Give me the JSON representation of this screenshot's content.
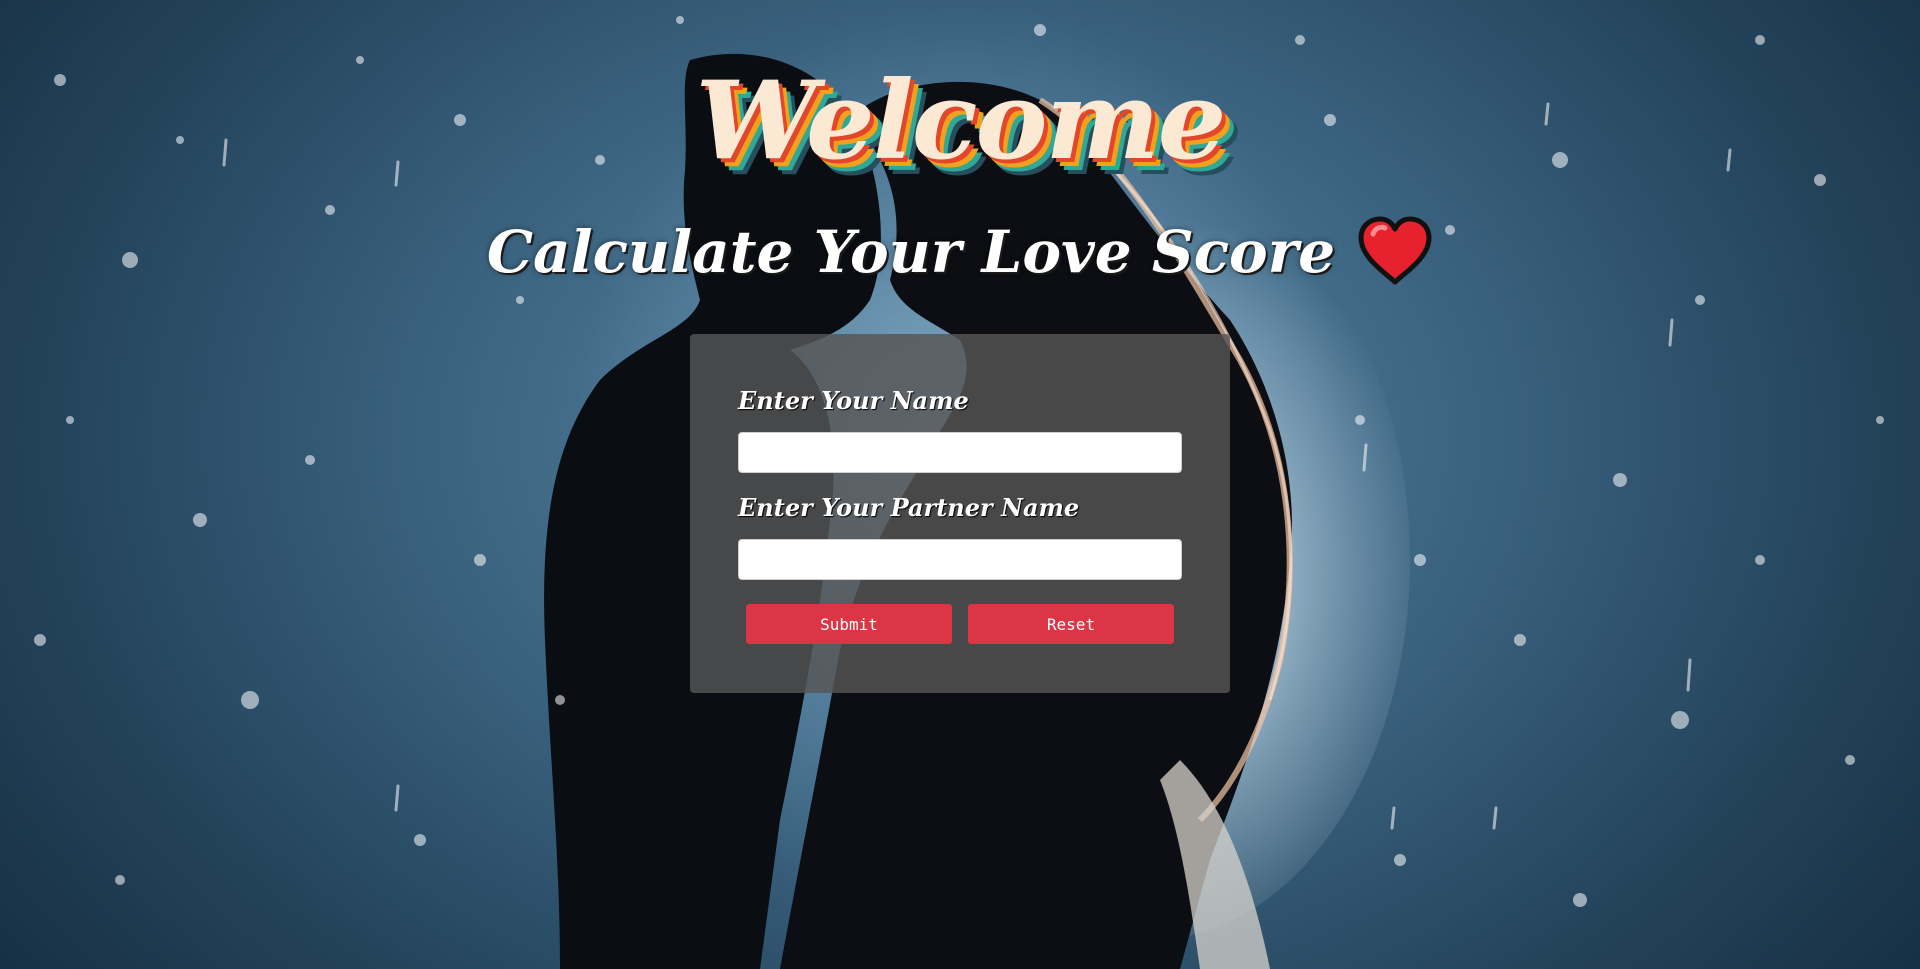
{
  "hero": {
    "welcome": "Welcome",
    "subtitle": "Calculate Your Love Score"
  },
  "form": {
    "name_label": "Enter Your Name",
    "name_value": "",
    "partner_label": "Enter Your Partner Name",
    "partner_value": "",
    "submit_label": "Submit",
    "reset_label": "Reset"
  },
  "icons": {
    "heart": "heart-icon"
  },
  "colors": {
    "button": "#dc3545",
    "card": "#555555",
    "welcome_text": "#fbe9d4",
    "heart": "#e8212f"
  }
}
